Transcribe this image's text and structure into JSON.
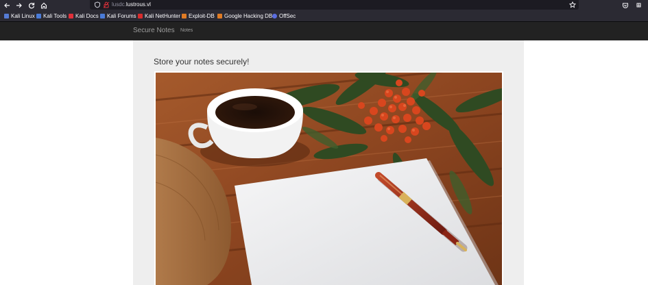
{
  "browser": {
    "url_host_prefix": "lusdc.",
    "url_host_main": "lustrous.vl",
    "icons": {
      "back": "arrow-left-icon",
      "forward": "arrow-right-icon",
      "reload": "reload-icon",
      "home": "home-icon",
      "shield": "shield-icon",
      "lock": "lock-icon",
      "bookmark_star": "star-icon",
      "pocket": "pocket-icon",
      "extensions": "extensions-icon"
    }
  },
  "bookmarks": [
    {
      "label": "Kali Linux",
      "icon": "kali-icon",
      "color": "#557bd5"
    },
    {
      "label": "Kali Tools",
      "icon": "kali-tools-icon",
      "color": "#4a7bd8"
    },
    {
      "label": "Kali Docs",
      "icon": "kali-docs-icon",
      "color": "#e0303a"
    },
    {
      "label": "Kali Forums",
      "icon": "kali-forums-icon",
      "color": "#4a7bd8"
    },
    {
      "label": "Kali NetHunter",
      "icon": "nethunter-icon",
      "color": "#d82c2c"
    },
    {
      "label": "Exploit-DB",
      "icon": "exploit-db-icon",
      "color": "#e07b24"
    },
    {
      "label": "Google Hacking DB",
      "icon": "ghdb-icon",
      "color": "#e07b24"
    },
    {
      "label": "OffSec",
      "icon": "offsec-icon",
      "color": "#5a6de0"
    }
  ],
  "site": {
    "brand": "Secure Notes",
    "nav": [
      "Notes"
    ],
    "heading": "Store your notes securely!",
    "colors": {
      "navbar": "#222222",
      "content_bg": "#eeeeee"
    }
  }
}
